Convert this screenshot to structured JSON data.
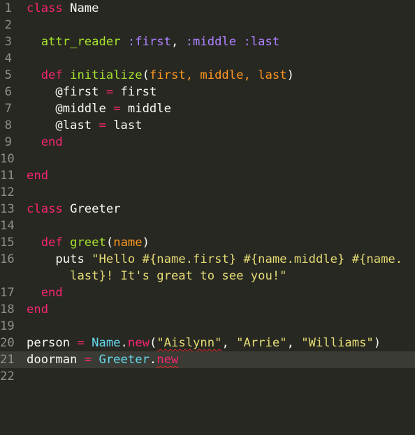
{
  "colors": {
    "background": "#272822",
    "current_line": "#3a3b34",
    "gutter": "#8f908a",
    "keyword": "#f92672",
    "function": "#a6e22e",
    "class_ref": "#66d9ef",
    "param": "#fd971f",
    "string": "#e6db74",
    "symbol": "#ae81ff",
    "text": "#f8f8f2",
    "spell_error": "#e0232b"
  },
  "line_numbers": [
    "1",
    "2",
    "3",
    "4",
    "5",
    "6",
    "7",
    "8",
    "9",
    "10",
    "11",
    "12",
    "13",
    "14",
    "15",
    "16",
    "17",
    "18",
    "19",
    "20",
    "21",
    "22"
  ],
  "code": {
    "l1": {
      "kw": "class",
      "rest": " Name"
    },
    "l3": {
      "indent": "  ",
      "fn": "attr_reader",
      "sp": " ",
      "s1": ":first",
      "comma": ", ",
      "s2": ":middle",
      "sp2": " ",
      "s3": ":last"
    },
    "l5": {
      "indent": "  ",
      "kw": "def",
      "sp": " ",
      "fn": "initialize",
      "open": "(",
      "params": "first, middle, last",
      "close": ")"
    },
    "l6": {
      "indent": "    ",
      "text": "@first = first",
      "ivar": "@first",
      "op": " = ",
      "val": "first"
    },
    "l7": {
      "indent": "    ",
      "ivar": "@middle",
      "op": " = ",
      "val": "middle"
    },
    "l8": {
      "indent": "    ",
      "ivar": "@last",
      "op": " = ",
      "val": "last"
    },
    "l9": {
      "indent": "  ",
      "kw": "end"
    },
    "l11": {
      "kw": "end"
    },
    "l13": {
      "kw": "class",
      "rest": " Greeter"
    },
    "l15": {
      "indent": "  ",
      "kw": "def",
      "sp": " ",
      "fn": "greet",
      "open": "(",
      "params": "name",
      "close": ")"
    },
    "l16a": {
      "indent": "    ",
      "call": "puts",
      "sp": " ",
      "str": "\"Hello #{name.first} #{name.middle} #{name."
    },
    "l16b": {
      "indent": "      ",
      "str": "last}! It's great to see you!\""
    },
    "l17": {
      "indent": "  ",
      "kw": "end"
    },
    "l18": {
      "kw": "end"
    },
    "l20": {
      "var": "person",
      "op": " = ",
      "cls": "Name",
      "dot": ".",
      "method": "new",
      "open": "(",
      "a1": "\"Aislynn\"",
      "c1": ", ",
      "a2": "\"Arrie\"",
      "c2": ", ",
      "a3": "\"Williams\"",
      "close": ")"
    },
    "l21": {
      "var": "doorman",
      "op": " = ",
      "cls": "Greeter",
      "dot": ".",
      "method": "new"
    }
  }
}
